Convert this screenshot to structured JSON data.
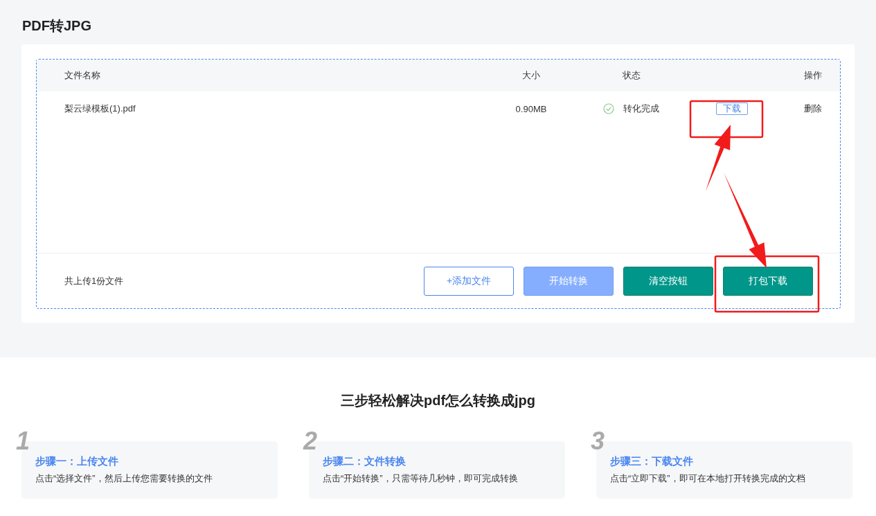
{
  "page_title": "PDF转JPG",
  "table": {
    "columns": [
      "文件名称",
      "大小",
      "状态",
      "操作"
    ],
    "rows": [
      {
        "name": "梨云绿模板(1).pdf",
        "size": "0.90MB",
        "status": "转化完成",
        "done": true,
        "download": "下载",
        "delete": "删除"
      }
    ]
  },
  "footer": {
    "count": "共上传1份文件",
    "buttons": [
      {
        "label": "+添加文件",
        "kind": "outline"
      },
      {
        "label": "开始转换",
        "kind": "light"
      },
      {
        "label": "清空按钮",
        "kind": "solid"
      },
      {
        "label": "打包下载",
        "kind": "solid"
      }
    ]
  },
  "steps_title": "三步轻松解决pdf怎么转换成jpg",
  "steps": [
    {
      "number": "1",
      "title": "步骤一：上传文件",
      "text": "点击“选择文件”，然后上传您需要转换的文件"
    },
    {
      "number": "2",
      "title": "步骤二：文件转换",
      "text": "点击“开始转换”，只需等待几秒钟，即可完成转换"
    },
    {
      "number": "3",
      "title": "步骤三：下载文件",
      "text": "点击“立即下载”，即可在本地打开转换完成的文档"
    }
  ]
}
